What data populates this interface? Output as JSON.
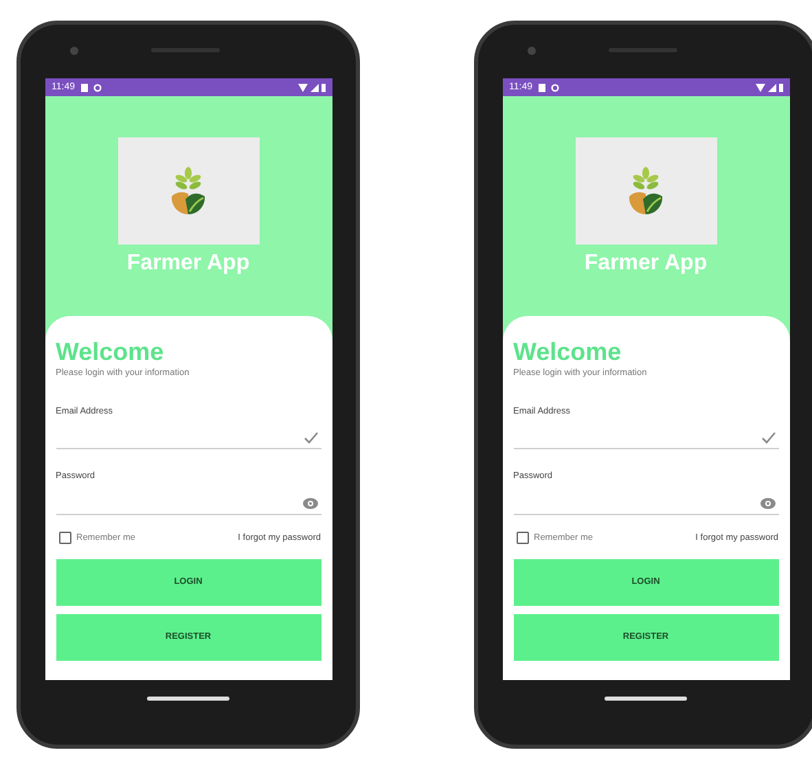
{
  "phones": [
    {
      "status_bar": {
        "time": "11:49"
      },
      "app_title": "Farmer App",
      "heading": "Welcome",
      "subtitle": "Please login with your information",
      "fields": [
        {
          "label": "Email Address",
          "kind": "email"
        },
        {
          "label": "Password",
          "kind": "password"
        }
      ],
      "remember": {
        "label": "Remember me",
        "checked": false
      },
      "forgot_link": "I forgot my password",
      "buttons": [
        "LOGIN",
        "REGISTER"
      ]
    },
    {
      "status_bar": {
        "time": "11:49"
      },
      "app_title": "Farmer App",
      "heading": "Welcome",
      "subtitle": "Please login with your information",
      "fields": [
        {
          "label": "Email Address",
          "kind": "email"
        },
        {
          "label": "Password",
          "kind": "password"
        }
      ],
      "remember": {
        "label": "Remember me",
        "checked": false
      },
      "forgot_link": "I forgot my password",
      "buttons": [
        "LOGIN",
        "REGISTER"
      ]
    }
  ]
}
